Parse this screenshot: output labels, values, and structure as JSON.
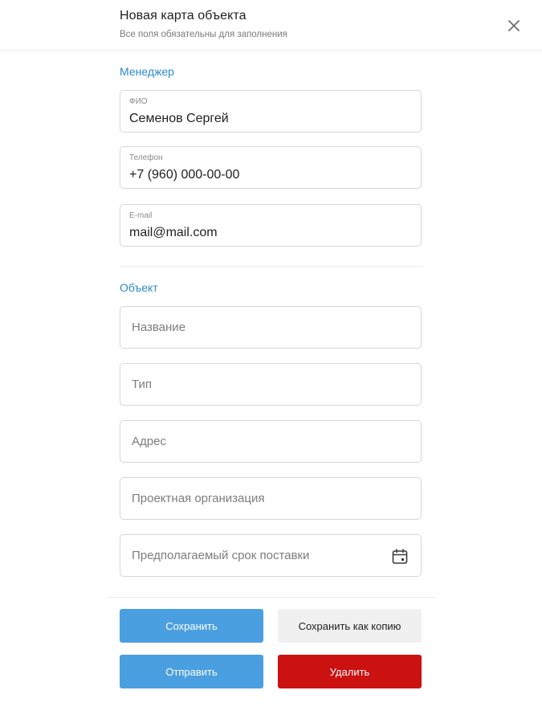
{
  "header": {
    "title": "Новая карта объекта",
    "subtitle": "Все поля обязательны для заполнения"
  },
  "manager": {
    "section_title": "Менеджер",
    "fio": {
      "label": "ФИО",
      "value": "Семенов Сергей"
    },
    "phone": {
      "label": "Телефон",
      "value": "+7 (960) 000-00-00"
    },
    "email": {
      "label": "E-mail",
      "value": "mail@mail.com"
    }
  },
  "object": {
    "section_title": "Объект",
    "name_placeholder": "Название",
    "type_placeholder": "Тип",
    "address_placeholder": "Адрес",
    "org_placeholder": "Проектная организация",
    "delivery_placeholder": "Предполагаемый срок поставки"
  },
  "actions": {
    "save": "Сохранить",
    "save_copy": "Сохранить как копию",
    "send": "Отправить",
    "delete": "Удалить"
  },
  "colors": {
    "accent": "#2a8ad4",
    "primary_button": "#4a9fe0",
    "danger_button": "#cc1111",
    "secondary_button": "#f0f0f0"
  },
  "icons": {
    "close": "close-icon",
    "calendar": "calendar-icon"
  }
}
